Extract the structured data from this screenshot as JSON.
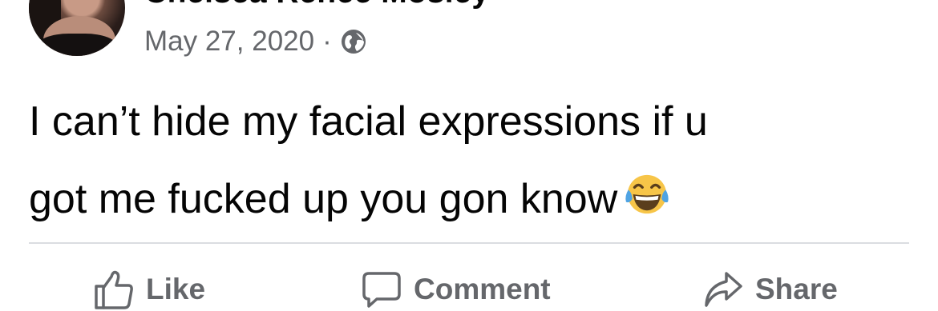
{
  "post": {
    "author": "Chelsea Renee Mosley",
    "date": "May 27, 2020",
    "separator": "·",
    "audience_icon": "globe-icon",
    "text_lines": [
      "I can’t hide my facial expressions if u",
      "got me fucked up you gon know"
    ],
    "emoji": "face-with-tears-of-joy"
  },
  "actions": {
    "like_label": "Like",
    "comment_label": "Comment",
    "share_label": "Share"
  },
  "colors": {
    "text": "#050505",
    "secondary": "#65676b",
    "divider": "#dadde1",
    "emoji_face": "#f7c548"
  }
}
